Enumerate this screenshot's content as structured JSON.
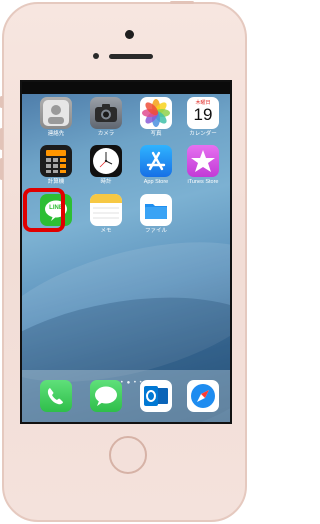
{
  "apps": [
    {
      "name": "contacts-app",
      "label": "連絡先",
      "color": "#9a9a9a"
    },
    {
      "name": "camera-app",
      "label": "カメラ",
      "color": "#5f6670"
    },
    {
      "name": "photos-app",
      "label": "写真",
      "color": "#ffffff"
    },
    {
      "name": "calendar-app",
      "label": "カレンダー",
      "color": "#ffffff",
      "weekday": "木曜日",
      "day": "19"
    },
    {
      "name": "calculator-app",
      "label": "計算機",
      "color": "#1c1c1c"
    },
    {
      "name": "clock-app",
      "label": "時計",
      "color": "#111111"
    },
    {
      "name": "appstore-app",
      "label": "App Store",
      "color": "#1e8cf0"
    },
    {
      "name": "itunes-app",
      "label": "iTunes Store",
      "color": "#d64ee0"
    },
    {
      "name": "line-app",
      "label": "",
      "color": "#2dbe34",
      "badge_text": "LINE"
    },
    {
      "name": "notes-app",
      "label": "メモ",
      "color": "#ffffff"
    },
    {
      "name": "files-app",
      "label": "ファイル",
      "color": "#ffffff"
    }
  ],
  "dock": [
    {
      "name": "phone-app",
      "color": "#3ec454"
    },
    {
      "name": "messages-app",
      "color": "#3ec454"
    },
    {
      "name": "outlook-app",
      "color": "#ffffff"
    },
    {
      "name": "safari-app",
      "color": "#ffffff"
    }
  ],
  "page_dots": "• • • ● • •"
}
